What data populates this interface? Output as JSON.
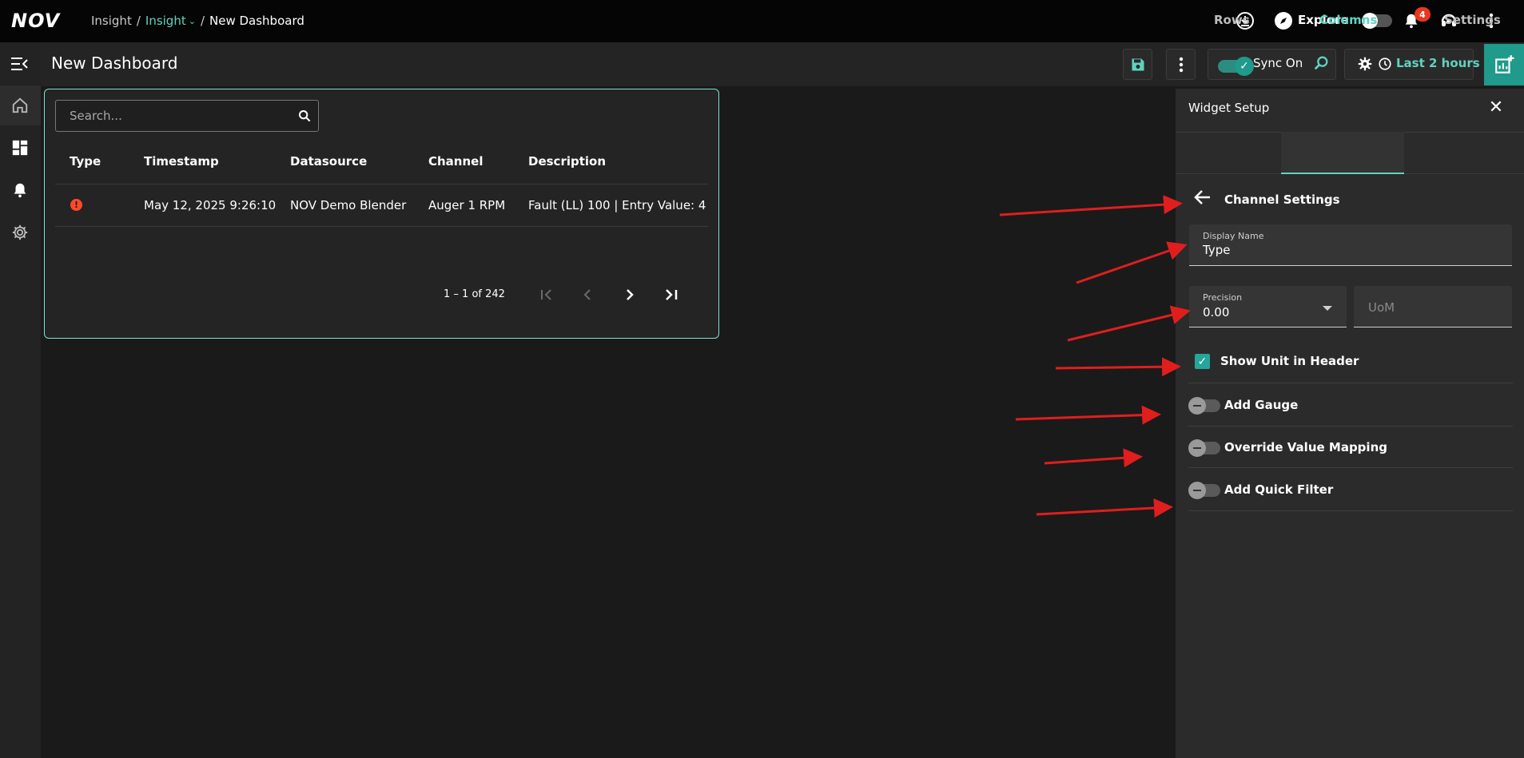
{
  "topbar": {
    "logo": "NOV",
    "breadcrumb": [
      "Insight",
      "Insight",
      "New Dashboard"
    ],
    "explore_label": "Explore",
    "notification_count": "4"
  },
  "toolbar": {
    "dashboard_title": "New Dashboard",
    "sync_label": "Sync On",
    "time_range_label": "Last 2 hours"
  },
  "widget": {
    "search_placeholder": "Search...",
    "columns": [
      "Type",
      "Timestamp",
      "Datasource",
      "Channel",
      "Description"
    ],
    "rows": [
      {
        "type": "!",
        "timestamp": "May 12, 2025 9:26:10",
        "datasource": "NOV Demo Blender",
        "channel": "Auger 1 RPM",
        "description": "Fault (LL) 100 | Entry Value: 4"
      }
    ],
    "pagination": "1 – 1 of 242"
  },
  "panel": {
    "title": "Widget Setup",
    "tabs": [
      "Rows",
      "Columns",
      "Settings"
    ],
    "active_tab": "Columns",
    "section_title": "Channel Settings",
    "display_name_label": "Display Name",
    "display_name_value": "Type",
    "precision_label": "Precision",
    "precision_value": "0.00",
    "uom_placeholder": "UoM",
    "show_unit_label": "Show Unit in Header",
    "show_unit_checked": true,
    "options": [
      {
        "label": "Add Gauge",
        "on": false
      },
      {
        "label": "Override Value Mapping",
        "on": false
      },
      {
        "label": "Add Quick Filter",
        "on": false
      }
    ]
  },
  "colors": {
    "accent": "#5fd3c0",
    "teal": "#1f9a8b",
    "alert": "#ff4a2a",
    "annotation_arrow": "#e01e1e"
  }
}
